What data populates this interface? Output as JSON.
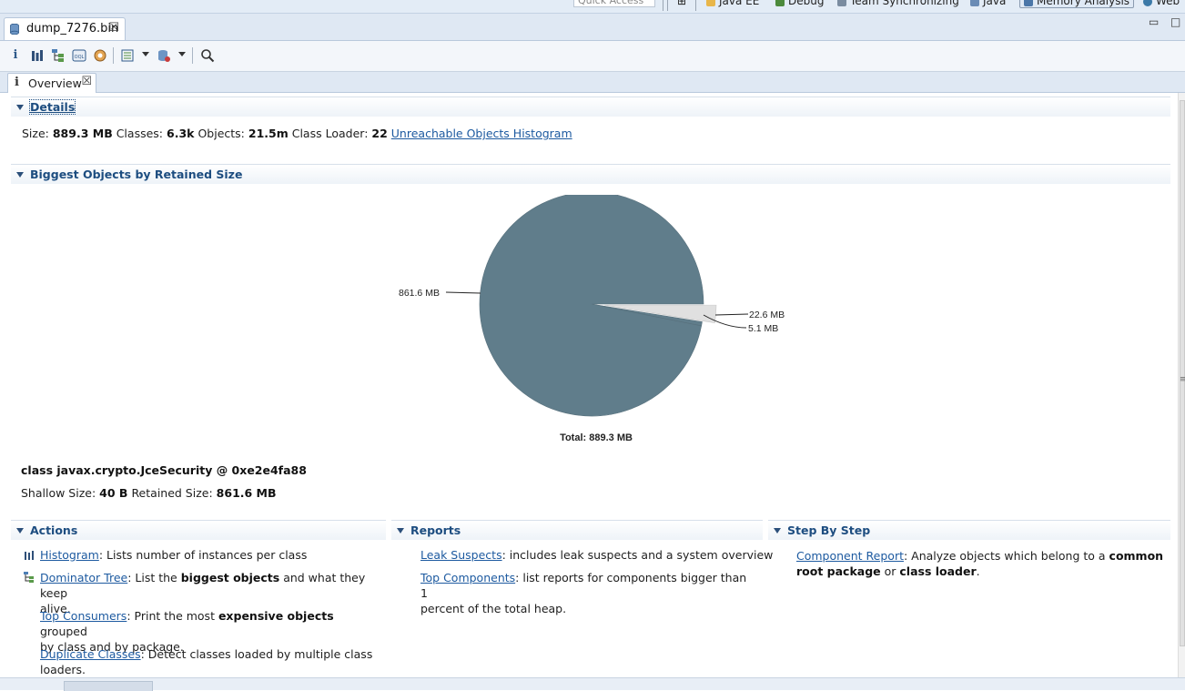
{
  "top": {
    "quick_access": "Quick Access",
    "perspectives": [
      {
        "label": "Java EE",
        "color": "#e8b64a"
      },
      {
        "label": "Debug",
        "color": "#4c8a3c"
      },
      {
        "label": "Team Synchronizing",
        "color": "#7a8ca0"
      },
      {
        "label": "Java",
        "color": "#6a8bb5"
      },
      {
        "label": "Memory Analysis",
        "color": "#4a76a8"
      },
      {
        "label": "Web",
        "color": "#3c7aa8"
      }
    ]
  },
  "editor_tab": {
    "label": "dump_7276.bin",
    "close": "☒"
  },
  "window_buttons": {
    "minimize": "▭",
    "maximize": "□"
  },
  "toolbar": {
    "icons": [
      "info-icon",
      "histogram-icon",
      "dominator-tree-icon",
      "oql-icon",
      "heap-dump-overview-icon",
      "query-browser-icon",
      "leak-identification-icon",
      "search-icon"
    ]
  },
  "inner_tab": {
    "icon": "i",
    "label": "Overview",
    "close": "☒"
  },
  "details": {
    "title": "Details",
    "size_label": "Size:",
    "size_value": "889.3 MB",
    "classes_label": "Classes:",
    "classes_value": "6.3k",
    "objects_label": "Objects:",
    "objects_value": "21.5m",
    "loader_label": "Class Loader:",
    "loader_value": "22",
    "unreachable_link": "Unreachable Objects Histogram"
  },
  "biggest": {
    "title": "Biggest Objects by Retained Size",
    "class_line": "class javax.crypto.JceSecurity @ 0xe2e4fa88",
    "shallow_label": "Shallow Size:",
    "shallow_value": "40 B",
    "retained_label": "Retained Size:",
    "retained_value": "861.6 MB"
  },
  "chart_data": {
    "type": "pie",
    "slices": [
      {
        "label": "861.6 MB",
        "value": 861.6,
        "color": "#607d8b"
      },
      {
        "label": "22.6 MB",
        "value": 22.6,
        "color": "#e0e0e0"
      },
      {
        "label": "5.1 MB",
        "value": 5.1,
        "color": "#607d8b"
      }
    ],
    "total_label": "Total: 889.3 MB",
    "unit": "MB"
  },
  "actions": {
    "title": "Actions",
    "items": [
      {
        "link": "Histogram",
        "text": ": Lists number of instances per class"
      },
      {
        "link": "Dominator Tree",
        "pre": ": List the ",
        "bold": "biggest objects",
        "post": " and what they keep",
        "line2": "alive."
      },
      {
        "link": "Top Consumers",
        "pre": ": Print the most ",
        "bold": "expensive objects",
        "post": " grouped",
        "line2": "by class and by package."
      },
      {
        "link": "Duplicate Classes",
        "pre": ": Detect classes loaded by multiple class",
        "line2": "loaders."
      }
    ]
  },
  "reports": {
    "title": "Reports",
    "items": [
      {
        "link": "Leak Suspects",
        "text": ": includes leak suspects and a system overview"
      },
      {
        "link": "Top Components",
        "text": ": list reports for components bigger than 1",
        "line2": "percent of the total heap."
      }
    ]
  },
  "stepbystep": {
    "title": "Step By Step",
    "link": "Component Report",
    "pre": ": Analyze objects which belong to a ",
    "bold1": "common",
    "bold2": "root package",
    "mid": " or ",
    "bold3": "class loader",
    "end": "."
  }
}
